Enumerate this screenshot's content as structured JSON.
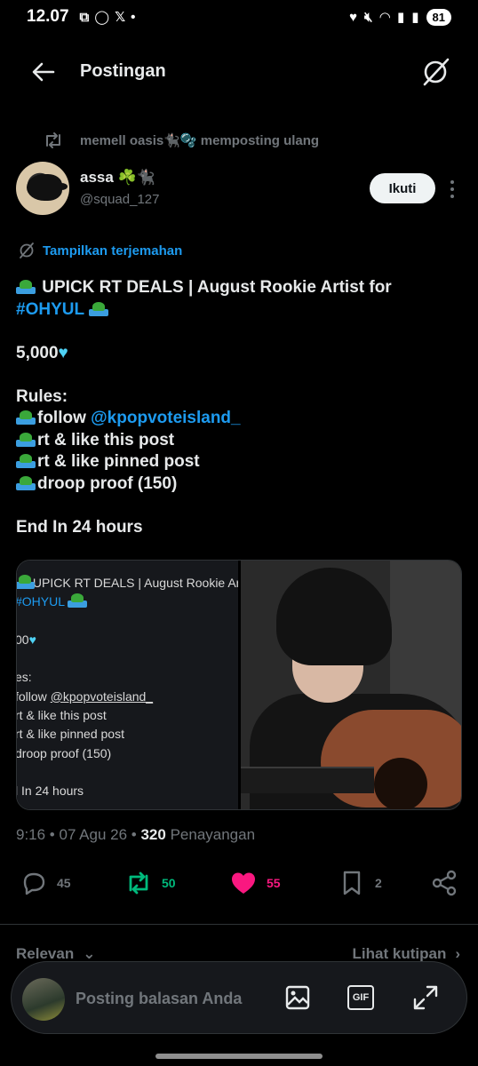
{
  "status": {
    "time": "12.07",
    "left_icons": [
      "screen-record-icon",
      "whatsapp-icon",
      "x-icon",
      "dot-icon"
    ],
    "right_icons": [
      "heart-icon",
      "mute-icon",
      "wifi-icon",
      "signal-icon",
      "signal-icon"
    ],
    "battery": "81"
  },
  "header": {
    "title": "Postingan"
  },
  "repost": {
    "text": "memell oasis🐈‍⬛🫧 memposting ulang"
  },
  "author": {
    "name": "assa ☘️🐈‍⬛",
    "handle": "@squad_127",
    "follow_label": "Ikuti"
  },
  "translate": {
    "label": "Tampilkan terjemahan"
  },
  "tweet": {
    "line1": " UPICK RT DEALS | August Rookie Artist for",
    "hashtag": "#OHYUL",
    "amount": "5,000",
    "rules_title": "Rules:",
    "rule1_prefix": "follow ",
    "rule1_link": "@kpopvoteisland_",
    "rule2": "rt & like this post",
    "rule3": "rt & like pinned post",
    "rule4": "droop proof (150)",
    "end": "End In 24 hours"
  },
  "media_text": {
    "l1": " UPICK RT DEALS | August Rookie Art",
    "l2": "#OHYUL",
    "l3": "00",
    "l4": "es:",
    "l5_prefix": "follow ",
    "l5_link": "@kpopvoteisland_",
    "l6": "rt & like this post",
    "l7": "rt & like pinned post",
    "l8": "droop proof (150)",
    "l9": "l In 24 hours"
  },
  "meta": {
    "time_date": "9:16 • 07 Agu 26 • ",
    "views": "320",
    "views_label": " Penayangan"
  },
  "actions": {
    "replies": "45",
    "reposts": "50",
    "likes": "55",
    "bookmarks": "2"
  },
  "tabs": {
    "left": "Relevan",
    "right": "Lihat kutipan"
  },
  "reply_bar": {
    "placeholder": "Posting balasan Anda",
    "gif_label": "GIF"
  },
  "colors": {
    "accent": "#1d9bf0",
    "repost": "#00ba7c",
    "like": "#f91880",
    "muted": "#71767b"
  }
}
